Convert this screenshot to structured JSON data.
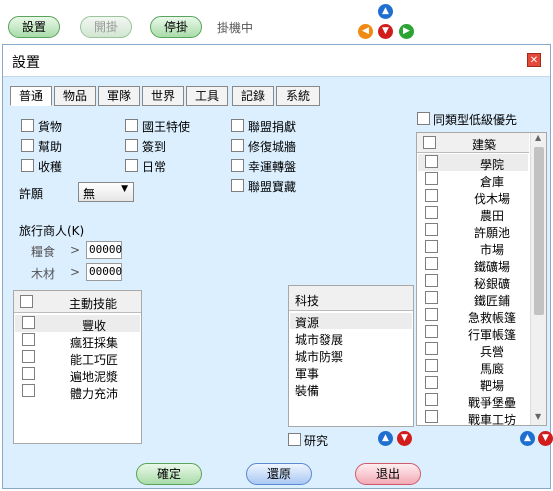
{
  "toolbar": {
    "settings": "設置",
    "start": "開掛",
    "stop": "停掛",
    "status": "掛機中"
  },
  "dialog": {
    "title": "設置",
    "close": "✕",
    "tabs": [
      "普通",
      "物品",
      "軍隊",
      "世界",
      "工具",
      "記錄",
      "系統"
    ],
    "checks_col1": [
      "貨物",
      "幫助",
      "收穫"
    ],
    "checks_col2": [
      "國王特使",
      "簽到",
      "日常"
    ],
    "checks_col3": [
      "聯盟捐獻",
      "修復城牆",
      "幸運轉盤",
      "聯盟寶藏"
    ],
    "wish_label": "許願",
    "wish_value": "無",
    "merchant": {
      "title": "旅行商人(K)",
      "food_label": "糧食",
      "wood_label": "木材",
      "gt": ">",
      "food_value": "00000",
      "wood_value": "00000"
    },
    "skills": {
      "header": "主動技能",
      "items": [
        "豐收",
        "瘋狂採集",
        "能工巧匠",
        "遍地泥漿",
        "體力充沛"
      ]
    },
    "tech": {
      "header": "科技",
      "items": [
        "資源",
        "城市發展",
        "城市防禦",
        "軍事",
        "裝備"
      ],
      "research_label": "研究"
    },
    "priority_label": "同類型低級優先",
    "buildings": {
      "header": "建築",
      "items": [
        "學院",
        "倉庫",
        "伐木場",
        "農田",
        "許願池",
        "市場",
        "鐵礦場",
        "秘銀礦",
        "鐵匠鋪",
        "急救帳篷",
        "行軍帳篷",
        "兵營",
        "馬廄",
        "靶場",
        "戰爭堡壘",
        "戰車工坊"
      ]
    },
    "buttons": {
      "ok": "確定",
      "reset": "還原",
      "exit": "退出"
    },
    "colors": {
      "accent_green": "#a9dca9",
      "dialog_bg": "#dcefff"
    }
  }
}
